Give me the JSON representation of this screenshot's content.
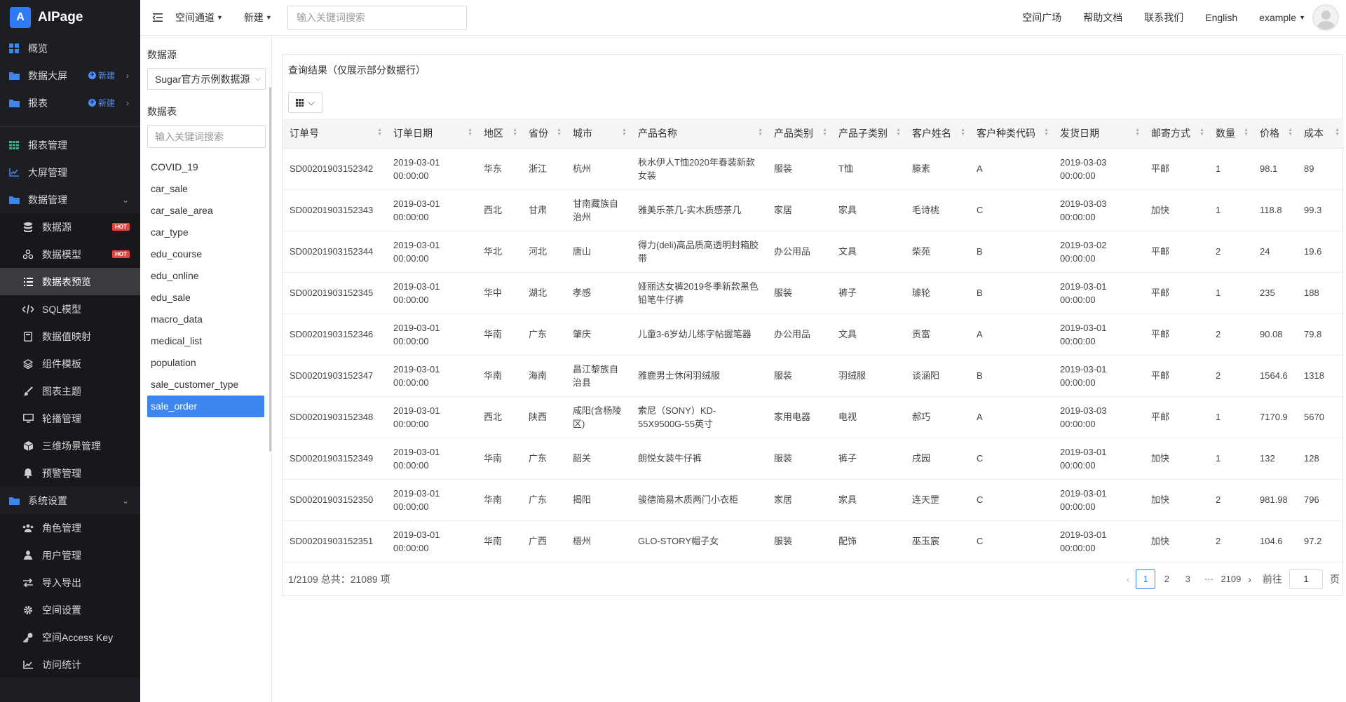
{
  "brand": {
    "logo": "A",
    "name": "AIPage"
  },
  "sidebar": {
    "new_label": "新建",
    "hot_label": "HOT",
    "top_items": [
      {
        "label": "概览",
        "icon": "grid-icon"
      },
      {
        "label": "数据大屏",
        "icon": "folder-icon"
      },
      {
        "label": "报表",
        "icon": "folder-icon"
      }
    ],
    "mgmt_items": [
      {
        "label": "报表管理",
        "icon": "table-icon"
      },
      {
        "label": "大屏管理",
        "icon": "chart-icon"
      },
      {
        "label": "数据管理",
        "icon": "folder-icon"
      }
    ],
    "data_sub": [
      {
        "label": "数据源",
        "icon": "database-icon"
      },
      {
        "label": "数据模型",
        "icon": "model-icon"
      },
      {
        "label": "数据表预览",
        "icon": "list-icon"
      },
      {
        "label": "SQL模型",
        "icon": "code-icon"
      },
      {
        "label": "数据值映射",
        "icon": "book-icon"
      },
      {
        "label": "组件模板",
        "icon": "layers-icon"
      },
      {
        "label": "图表主题",
        "icon": "brush-icon"
      },
      {
        "label": "轮播管理",
        "icon": "monitor-icon"
      },
      {
        "label": "三维场景管理",
        "icon": "cube-icon"
      },
      {
        "label": "预警管理",
        "icon": "bell-icon"
      }
    ],
    "system": {
      "label": "系统设置",
      "icon": "folder-icon"
    },
    "system_sub": [
      {
        "label": "角色管理",
        "icon": "users-icon"
      },
      {
        "label": "用户管理",
        "icon": "user-icon"
      },
      {
        "label": "导入导出",
        "icon": "swap-icon"
      },
      {
        "label": "空间设置",
        "icon": "gear-icon"
      },
      {
        "label": "空间Access Key",
        "icon": "key-icon"
      },
      {
        "label": "访问统计",
        "icon": "stats-icon"
      }
    ]
  },
  "topbar": {
    "space_channel": "空间通道",
    "new": "新建",
    "search_placeholder": "输入关键词搜索",
    "links": [
      "空间广场",
      "帮助文档",
      "联系我们",
      "English"
    ],
    "user": "example"
  },
  "datasource": {
    "label": "数据源",
    "selected": "Sugar官方示例数据源",
    "table_label": "数据表",
    "search_placeholder": "输入关键词搜索",
    "tables": [
      "COVID_19",
      "car_sale",
      "car_sale_area",
      "car_type",
      "edu_course",
      "edu_online",
      "edu_sale",
      "macro_data",
      "medical_list",
      "population",
      "sale_customer_type",
      "sale_order"
    ],
    "active_table": "sale_order"
  },
  "result": {
    "title": "查询结果（仅展示部分数据行）",
    "columns": [
      "订单号",
      "订单日期",
      "地区",
      "省份",
      "城市",
      "产品名称",
      "产品类别",
      "产品子类别",
      "客户姓名",
      "客户种类代码",
      "发货日期",
      "邮寄方式",
      "数量",
      "价格",
      "成本"
    ],
    "rows": [
      [
        "SD00201903152342",
        "2019-03-01 00:00:00",
        "华东",
        "浙江",
        "杭州",
        "秋水伊人T恤2020年春装新款女装",
        "服装",
        "T恤",
        "滕素",
        "A",
        "2019-03-03 00:00:00",
        "平邮",
        "1",
        "98.1",
        "89"
      ],
      [
        "SD00201903152343",
        "2019-03-01 00:00:00",
        "西北",
        "甘肃",
        "甘南藏族自治州",
        "雅美乐茶几-实木质感茶几",
        "家居",
        "家具",
        "毛诗桃",
        "C",
        "2019-03-03 00:00:00",
        "加快",
        "1",
        "118.8",
        "99.3"
      ],
      [
        "SD00201903152344",
        "2019-03-01 00:00:00",
        "华北",
        "河北",
        "唐山",
        "得力(deli)高品质高透明封箱胶带",
        "办公用品",
        "文具",
        "柴苑",
        "B",
        "2019-03-02 00:00:00",
        "平邮",
        "2",
        "24",
        "19.6"
      ],
      [
        "SD00201903152345",
        "2019-03-01 00:00:00",
        "华中",
        "湖北",
        "孝感",
        "娅丽达女裤2019冬季新款黑色铅笔牛仔裤",
        "服装",
        "裤子",
        "璩轮",
        "B",
        "2019-03-01 00:00:00",
        "平邮",
        "1",
        "235",
        "188"
      ],
      [
        "SD00201903152346",
        "2019-03-01 00:00:00",
        "华南",
        "广东",
        "肇庆",
        "儿童3-6岁幼儿练字帖握笔器",
        "办公用品",
        "文具",
        "贡富",
        "A",
        "2019-03-01 00:00:00",
        "平邮",
        "2",
        "90.08",
        "79.8"
      ],
      [
        "SD00201903152347",
        "2019-03-01 00:00:00",
        "华南",
        "海南",
        "昌江黎族自治县",
        "雅鹿男士休闲羽绒服",
        "服装",
        "羽绒服",
        "谈涵阳",
        "B",
        "2019-03-01 00:00:00",
        "平邮",
        "2",
        "1564.6",
        "1318"
      ],
      [
        "SD00201903152348",
        "2019-03-01 00:00:00",
        "西北",
        "陕西",
        "咸阳(含杨陵区)",
        "索尼（SONY）KD-55X9500G-55英寸",
        "家用电器",
        "电视",
        "郝巧",
        "A",
        "2019-03-03 00:00:00",
        "平邮",
        "1",
        "7170.9",
        "5670"
      ],
      [
        "SD00201903152349",
        "2019-03-01 00:00:00",
        "华南",
        "广东",
        "韶关",
        "朗悦女装牛仔裤",
        "服装",
        "裤子",
        "戌园",
        "C",
        "2019-03-01 00:00:00",
        "加快",
        "1",
        "132",
        "128"
      ],
      [
        "SD00201903152350",
        "2019-03-01 00:00:00",
        "华南",
        "广东",
        "揭阳",
        "骏德简易木质两门小衣柜",
        "家居",
        "家具",
        "连天罡",
        "C",
        "2019-03-01 00:00:00",
        "加快",
        "2",
        "981.98",
        "796"
      ],
      [
        "SD00201903152351",
        "2019-03-01 00:00:00",
        "华南",
        "广西",
        "梧州",
        "GLO-STORY帽子女",
        "服装",
        "配饰",
        "巫玉宸",
        "C",
        "2019-03-01 00:00:00",
        "加快",
        "2",
        "104.6",
        "97.2"
      ]
    ],
    "pager": {
      "info": "1/2109 总共：21089 项",
      "pages": [
        "1",
        "2",
        "3",
        "···",
        "2109"
      ],
      "goto_label": "前往",
      "goto_value": "1",
      "page_suffix": "页"
    }
  }
}
